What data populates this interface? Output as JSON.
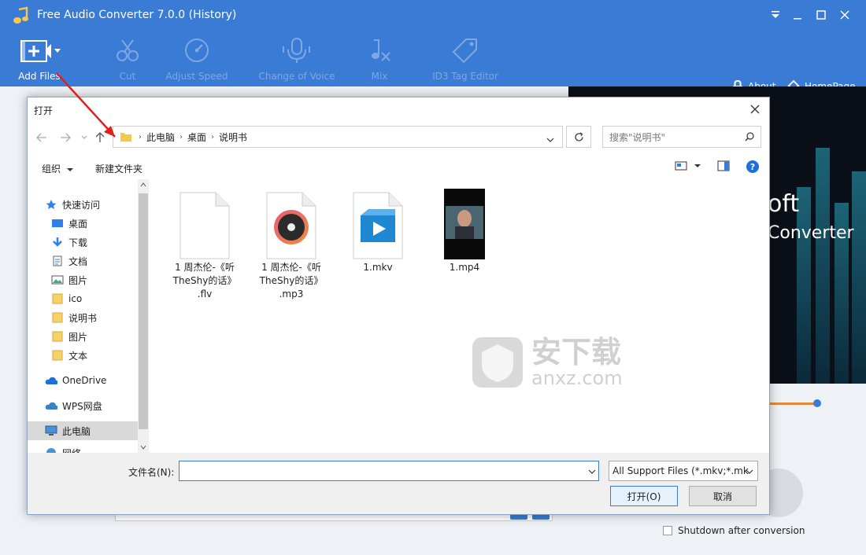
{
  "app": {
    "title": "Free Audio Converter 7.0.0 (History)",
    "toolbar": {
      "add_files": "Add Files",
      "cut": "Cut",
      "adjust_speed": "Adjust Speed",
      "change_voice": "Change of Voice",
      "mix": "Mix",
      "id3": "ID3 Tag Editor",
      "about": "About",
      "homepage": "HomePage"
    },
    "banner": {
      "line1": "oft",
      "line2": "Converter"
    },
    "shutdown_label": "Shutdown after conversion",
    "brand_color": "#3a7bd5"
  },
  "dialog": {
    "title": "打开",
    "breadcrumb": [
      "此电脑",
      "桌面",
      "说明书"
    ],
    "search_placeholder": "搜索\"说明书\"",
    "organize": "组织",
    "new_folder": "新建文件夹",
    "nav": {
      "quick_access": "快速访问",
      "desktop": "桌面",
      "downloads": "下载",
      "documents": "文档",
      "pictures": "图片",
      "ico": "ico",
      "manual": "说明书",
      "pictures2": "图片",
      "text": "文本",
      "onedrive": "OneDrive",
      "wps": "WPS网盘",
      "this_pc": "此电脑",
      "network": "网络"
    },
    "files": [
      {
        "name": "1 周杰伦-《听TheShy的话》.flv",
        "l1": "1 周杰伦-《听",
        "l2": "TheShy的话》",
        "l3": ".flv",
        "type": "flv"
      },
      {
        "name": "1 周杰伦-《听TheShy的话》.mp3",
        "l1": "1 周杰伦-《听",
        "l2": "TheShy的话》",
        "l3": ".mp3",
        "type": "mp3"
      },
      {
        "name": "1.mkv",
        "l1": "1.mkv",
        "type": "mkv"
      },
      {
        "name": "1.mp4",
        "l1": "1.mp4",
        "type": "mp4"
      }
    ],
    "watermark": {
      "cn": "安下载",
      "en": "anxz.com"
    },
    "filename_label": "文件名(N):",
    "filename_value": "",
    "filetype": "All Support Files (*.mkv;*.mk",
    "open_button": "打开(O)",
    "cancel_button": "取消"
  }
}
